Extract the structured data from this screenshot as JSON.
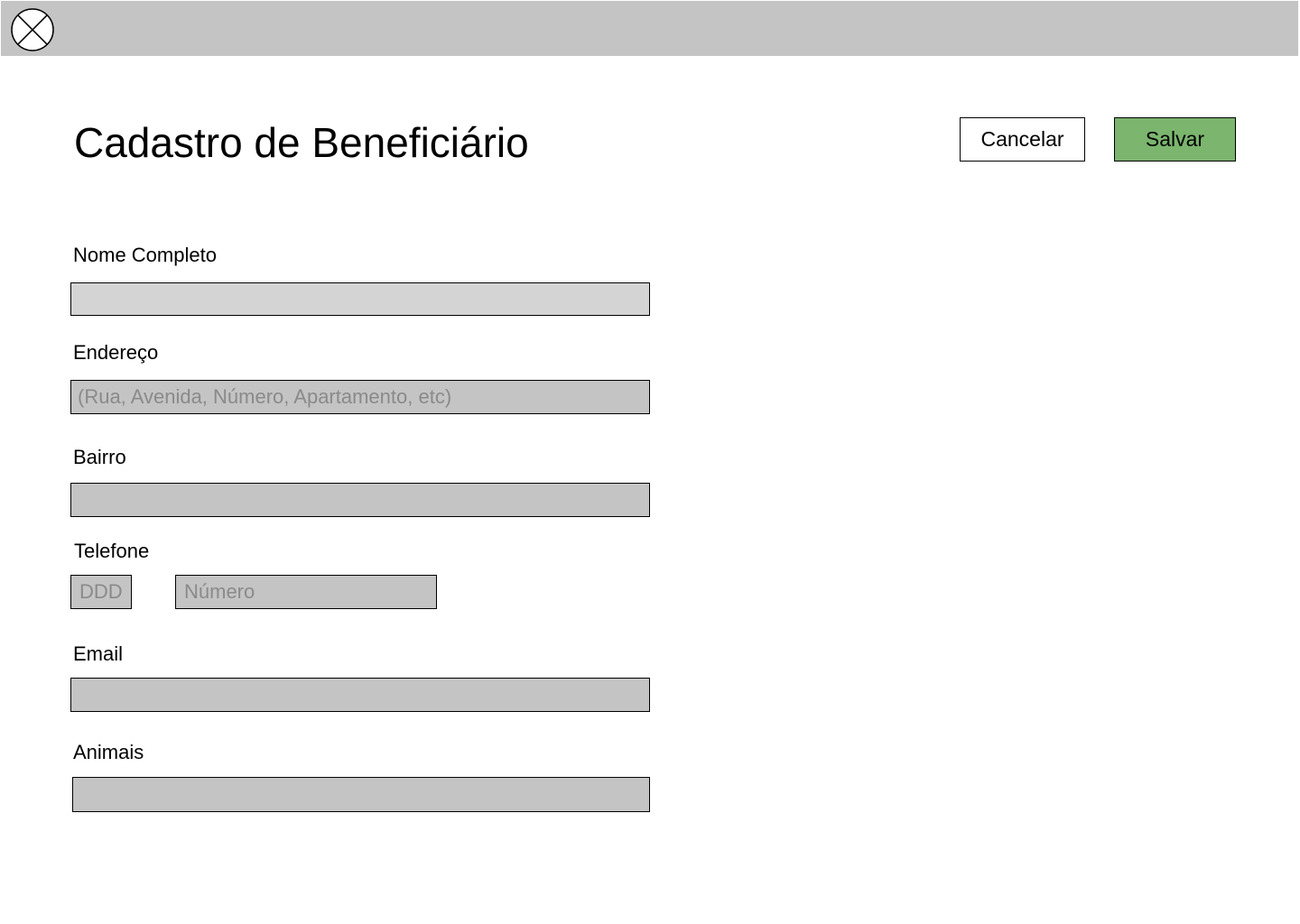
{
  "header": {
    "logo_icon": "circle-x-icon"
  },
  "page": {
    "title": "Cadastro de Beneficiário"
  },
  "actions": {
    "cancel_label": "Cancelar",
    "save_label": "Salvar",
    "save_color": "#7bb56e"
  },
  "form": {
    "nome": {
      "label": "Nome Completo",
      "value": "",
      "placeholder": ""
    },
    "endereco": {
      "label": "Endereço",
      "value": "",
      "placeholder": "(Rua, Avenida, Número, Apartamento, etc)"
    },
    "bairro": {
      "label": "Bairro",
      "value": "",
      "placeholder": ""
    },
    "telefone": {
      "label": "Telefone",
      "ddd_placeholder": "DDD",
      "numero_placeholder": "Número"
    },
    "email": {
      "label": "Email",
      "value": "",
      "placeholder": ""
    },
    "animais": {
      "label": "Animais",
      "value": "",
      "placeholder": ""
    }
  }
}
